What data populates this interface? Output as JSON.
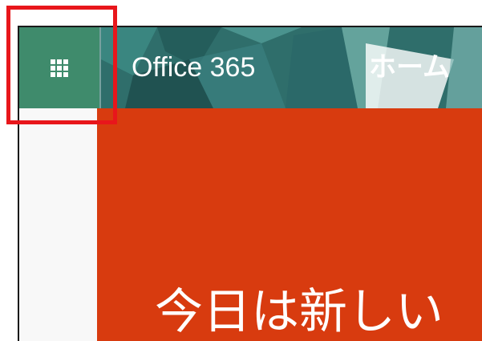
{
  "header": {
    "app_launcher_icon": "waffle-icon",
    "brand": "Office 365",
    "page": "ホーム"
  },
  "hero": {
    "headline": "今日は新しい"
  },
  "annotation": {
    "color": "#e8161b"
  },
  "colors": {
    "launcher_bg": "#3f8b6c",
    "header_bg": "#2f6e6b",
    "hero_bg": "#d83b0f"
  }
}
